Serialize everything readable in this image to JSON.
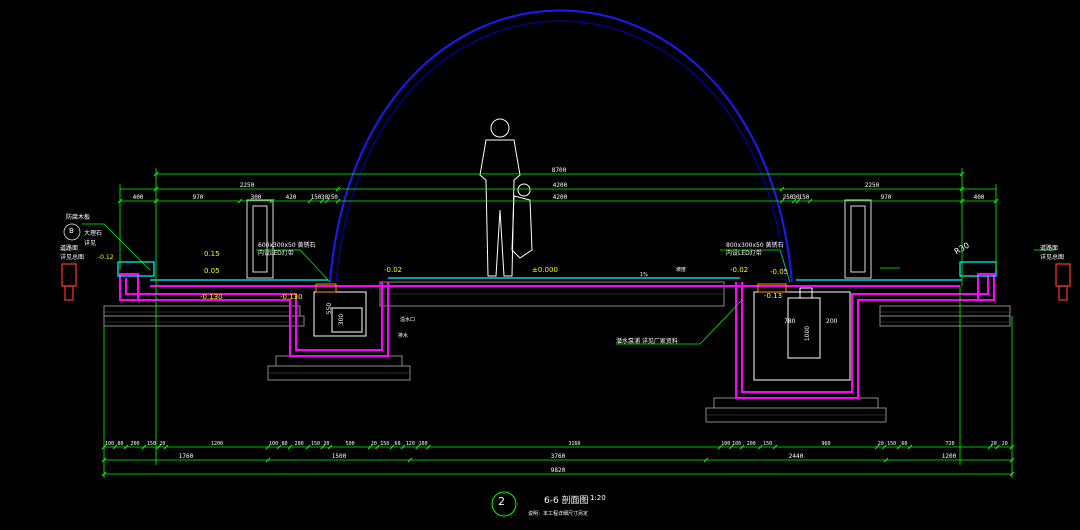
{
  "drawing": {
    "title": "6-6 剖面图",
    "scale": "1:20",
    "section_no": "2",
    "subtitle": "说明：本工程详细尺寸另定",
    "top_dims": {
      "overall": "8700",
      "row2": [
        "2250",
        "4200",
        "2250"
      ],
      "row3": [
        "400",
        "970",
        "300",
        "420",
        "150",
        "30",
        "250",
        "4200",
        "250",
        "30",
        "150",
        "970",
        "400"
      ]
    },
    "bottom_dims": {
      "row1": [
        "100",
        "80",
        "200",
        "150",
        "20",
        "1200",
        "100",
        "80",
        "200",
        "150",
        "20",
        "500",
        "20",
        "150",
        "60",
        "120",
        "100",
        "3160",
        "100",
        "100",
        "200",
        "150",
        "960",
        "20",
        "150",
        "60",
        "720",
        "20",
        "20"
      ],
      "row2": [
        "1760",
        "1500",
        "3760",
        "2440",
        "1200"
      ],
      "overall": "9820"
    },
    "levels": {
      "left_top": "0.15",
      "left_mid": "0.05",
      "left_low": "-0.130",
      "left_pool": "-0.130",
      "center_left": "-0.02",
      "center": "±0.000",
      "right_a": "-0.02",
      "right_b": "-0.05",
      "right_c": "-0.13",
      "left_edge": "-0.12"
    },
    "notes": {
      "light_left": "600x300x50 黄锈石",
      "light_left2": "内设LED灯带",
      "light_right": "800x300x50 黄锈石",
      "light_right2": "内设LED灯带",
      "left_callout": "防腐木板",
      "left_callout2": "B",
      "left_sub": "大理石",
      "left_sub2": "详见",
      "far_left": "道路面",
      "far_left2": "详见总图",
      "far_right": "道路面",
      "far_right2": "详见总图",
      "radius": "R30",
      "pump_note": "潜水泵浦 详见厂家资料",
      "pool_dim1": "550",
      "pool_dim2": "300",
      "pool_dim3": "780",
      "pool_dim4": "1000",
      "pool_dim5": "200",
      "overflow": "溢水口",
      "drain": "排水",
      "slope": "坡度",
      "slope2": "1%"
    },
    "colors": {
      "background": "#000000",
      "dimension": "#00ff00",
      "structure": "#ff00ff",
      "fill": "#808080",
      "water_arc": "#0000ff",
      "figure": "#ffffff",
      "cyan": "#00ffff",
      "accent_red": "#ff3333",
      "yellow": "#ffff00"
    }
  }
}
